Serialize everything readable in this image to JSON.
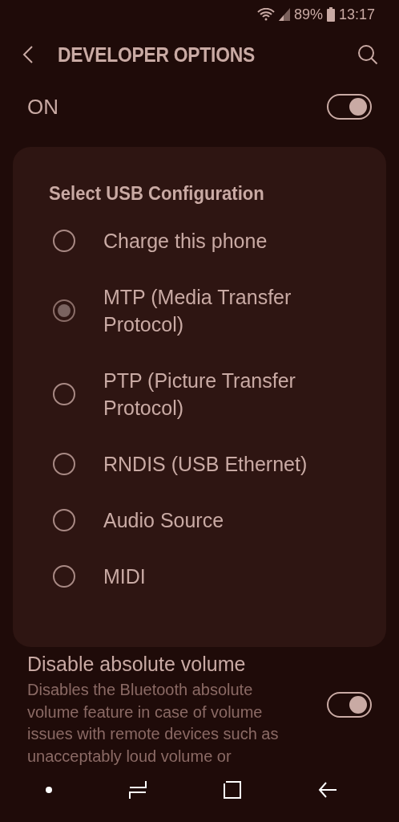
{
  "status_bar": {
    "battery": "89%",
    "time": "13:17"
  },
  "header": {
    "title": "DEVELOPER OPTIONS"
  },
  "master_switch": {
    "label": "ON",
    "on": true
  },
  "dialog": {
    "title": "Select USB Configuration",
    "options": [
      {
        "label": "Charge this phone",
        "selected": false
      },
      {
        "label": "MTP (Media Transfer Protocol)",
        "selected": true
      },
      {
        "label": "PTP (Picture Transfer Protocol)",
        "selected": false
      },
      {
        "label": "RNDIS (USB Ethernet)",
        "selected": false
      },
      {
        "label": "Audio Source",
        "selected": false
      },
      {
        "label": "MIDI",
        "selected": false
      }
    ]
  },
  "setting": {
    "title": "Disable absolute volume",
    "description": "Disables the Bluetooth absolute volume feature in case of volume issues with remote devices such as unacceptably loud volume or",
    "on": true
  }
}
